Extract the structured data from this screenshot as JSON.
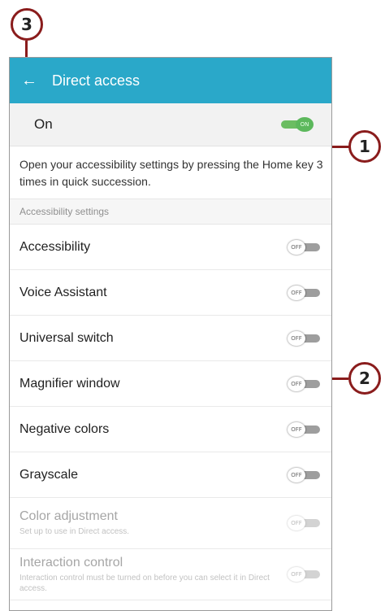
{
  "callouts": {
    "c1": "1",
    "c2": "2",
    "c3": "3"
  },
  "appbar": {
    "back_icon": "back-arrow-icon",
    "title": "Direct access"
  },
  "master": {
    "label": "On",
    "toggle_text": "ON",
    "checked": true
  },
  "description": "Open your accessibility settings by pressing the Home key 3 times in quick succession.",
  "section_header": "Accessibility settings",
  "items": [
    {
      "label": "Accessibility",
      "toggle_text": "OFF"
    },
    {
      "label": "Voice Assistant",
      "toggle_text": "OFF"
    },
    {
      "label": "Universal switch",
      "toggle_text": "OFF"
    },
    {
      "label": "Magnifier window",
      "toggle_text": "OFF"
    },
    {
      "label": "Negative colors",
      "toggle_text": "OFF"
    },
    {
      "label": "Grayscale",
      "toggle_text": "OFF"
    },
    {
      "label": "Color adjustment",
      "sub": "Set up to use in Direct access.",
      "toggle_text": "OFF"
    },
    {
      "label": "Interaction control",
      "sub": "Interaction control must be turned on before you can select it in Direct access.",
      "toggle_text": "OFF"
    }
  ],
  "colors": {
    "appbar": "#2aa8c9",
    "toggle_on": "#5cb85c",
    "callout_border": "#8a1c1c"
  }
}
